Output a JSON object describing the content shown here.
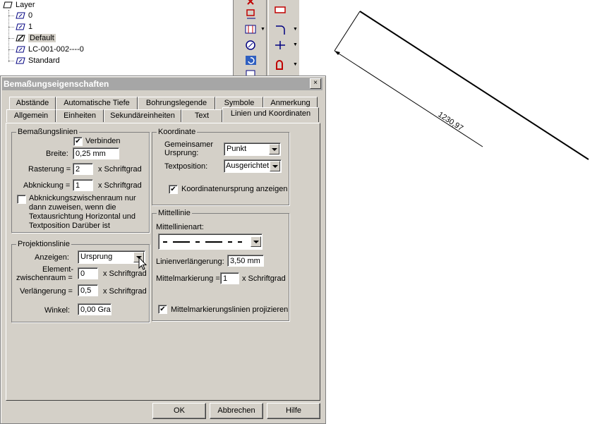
{
  "layer_tree": {
    "root_label": "Layer",
    "items": [
      {
        "label": "0",
        "selected": false
      },
      {
        "label": "1",
        "selected": false
      },
      {
        "label": "Default",
        "selected": true
      },
      {
        "label": "LC-001-002----0",
        "selected": false
      },
      {
        "label": "Standard",
        "selected": false
      }
    ]
  },
  "drawing": {
    "dimension_text": "1230,97"
  },
  "dialog": {
    "title": "Bemaßungseigenschaften",
    "close_label": "×",
    "tabs_back": [
      "Abstände",
      "Automatische Tiefe",
      "Bohrungslegende",
      "Symbole",
      "Anmerkung"
    ],
    "tabs_front": [
      "Allgemein",
      "Einheiten",
      "Sekundäreinheiten",
      "Text",
      "Linien und Koordinaten"
    ],
    "active_tab": "Linien und Koordinaten",
    "bemassungslinien": {
      "title": "Bemaßungslinien",
      "verbinden_label": "Verbinden",
      "verbinden_checked": true,
      "breite_label": "Breite:",
      "breite_value": "0,25 mm",
      "rasterung_label": "Rasterung =",
      "rasterung_value": "2",
      "rasterung_unit": "x Schriftgrad",
      "abknickung_label": "Abknickung =",
      "abknickung_value": "1",
      "abknickung_unit": "x Schriftgrad",
      "abknick_option_label": "Abknickungszwischenraum nur dann zuweisen, wenn die Textausrichtung Horizontal und Textposition Darüber ist",
      "abknick_option_checked": false
    },
    "projektionslinie": {
      "title": "Projektionslinie",
      "anzeigen_label": "Anzeigen:",
      "anzeigen_value": "Ursprung",
      "element_label_1": "Element-",
      "element_label_2": "zwischenraum =",
      "element_value": "0",
      "element_unit": "x Schriftgrad",
      "verlaengerung_label": "Verlängerung =",
      "verlaengerung_value": "0,5",
      "verlaengerung_unit": "x Schriftgrad",
      "winkel_label": "Winkel:",
      "winkel_value": "0,00 Gra"
    },
    "koordinate": {
      "title": "Koordinate",
      "ursprung_label_1": "Gemeinsamer",
      "ursprung_label_2": "Ursprung:",
      "ursprung_value": "Punkt",
      "textposition_label": "Textposition:",
      "textposition_value": "Ausgerichtet",
      "show_origin_label": "Koordinatenursprung anzeigen",
      "show_origin_checked": true
    },
    "mittellinie": {
      "title": "Mittellinie",
      "art_label": "Mittellinienart:",
      "verlaengerung_label": "Linienverlängerung:",
      "verlaengerung_value": "3,50 mm",
      "markierung_label": "Mittelmarkierung =",
      "markierung_value": "1",
      "markierung_unit": "x Schriftgrad",
      "project_label": "Mittelmarkierungslinien projizieren",
      "project_checked": true
    },
    "buttons": {
      "ok": "OK",
      "cancel": "Abbrechen",
      "help": "Hilfe"
    }
  }
}
